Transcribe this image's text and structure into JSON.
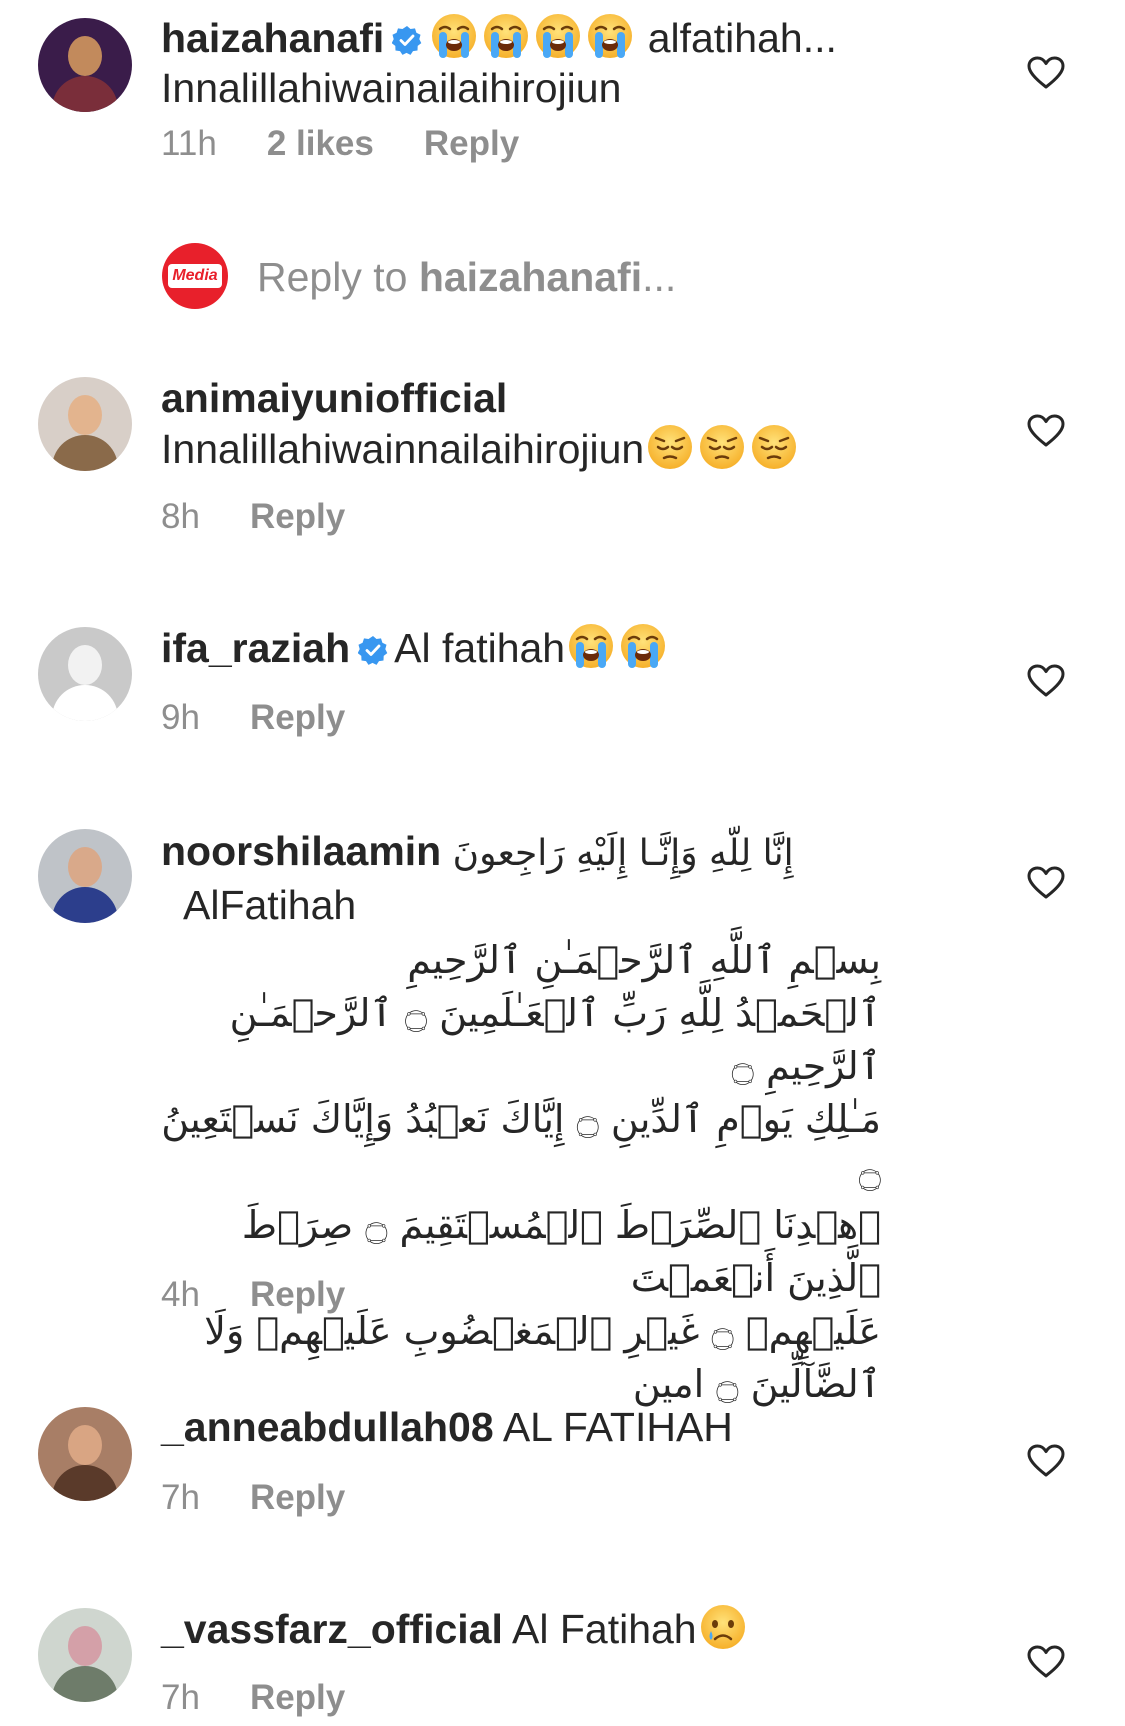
{
  "colors": {
    "text_primary": "#262626",
    "text_secondary": "#8e8e8e",
    "verified_blue": "#3897f0",
    "brand_red": "#e8202b"
  },
  "comments": [
    {
      "username": "haizahanafi",
      "verified": true,
      "text_before_emoji": "",
      "emojis": [
        "loudly-crying-face",
        "loudly-crying-face",
        "loudly-crying-face",
        "loudly-crying-face"
      ],
      "text_after_emoji": "alfatihah...",
      "line2": "Innalillahiwainailaihirojiun",
      "time": "11h",
      "likes": "2 likes",
      "reply_label": "Reply"
    },
    {
      "username": "animaiyuniofficial",
      "verified": false,
      "text": "Innalillahiwainnailaihirojiun",
      "emojis": [
        "pensive-face",
        "pensive-face",
        "pensive-face"
      ],
      "time": "8h",
      "reply_label": "Reply"
    },
    {
      "username": "ifa_raziah",
      "verified": true,
      "text": "Al fatihah",
      "emojis": [
        "loudly-crying-face",
        "loudly-crying-face"
      ],
      "time": "9h",
      "reply_label": "Reply"
    },
    {
      "username": "noorshilaamin",
      "verified": false,
      "arabic_inline": "إِنَّا لِلّهِ وَإِنَّـا إِلَيْهِ رَاجِعونَ",
      "text": "AlFatihah",
      "arabic_lines": [
        "بِسۡمِ ٱللَّهِ ٱلرَّحۡمَـٰنِ ٱلرَّحِيمِ",
        "ٱلۡحَمۡدُ لِلَّهِ رَبِّ ٱلۡعَـٰلَمِينَ ۝ ٱلرَّحۡمَـٰنِ ٱلرَّحِيمِ ۝",
        "مَـٰلِكِ يَوۡمِ ٱلدِّينِ ۝ إِيَّاكَ نَعۡبُدُ وَإِيَّاكَ نَسۡتَعِينُ ۝",
        "ٱهۡدِنَا ٱلصِّرَٲطَ ٱلۡمُسۡتَقِيمَ ۝ صِرَٲطَ ٱلَّذِينَ أَنۡعَمۡتَ",
        "عَلَيۡهِمۡ ۝ غَيۡرِ ٱلۡمَغۡضُوبِ عَلَيۡهِمۡ وَلَا",
        "ٱلضَّآلِّينَ ۝ امين"
      ],
      "time": "4h",
      "reply_label": "Reply"
    },
    {
      "username": "_anneabdullah08",
      "verified": false,
      "text": "AL FATIHAH",
      "time": "7h",
      "reply_label": "Reply"
    },
    {
      "username": "_vassfarz_official",
      "verified": false,
      "text": "Al Fatihah",
      "emojis": [
        "crying-face"
      ],
      "time": "7h",
      "reply_label": "Reply"
    }
  ],
  "reply_composer": {
    "prefix": "Reply to ",
    "target": "haizahanafi",
    "suffix": "...",
    "avatar_logo_text": "Media"
  }
}
